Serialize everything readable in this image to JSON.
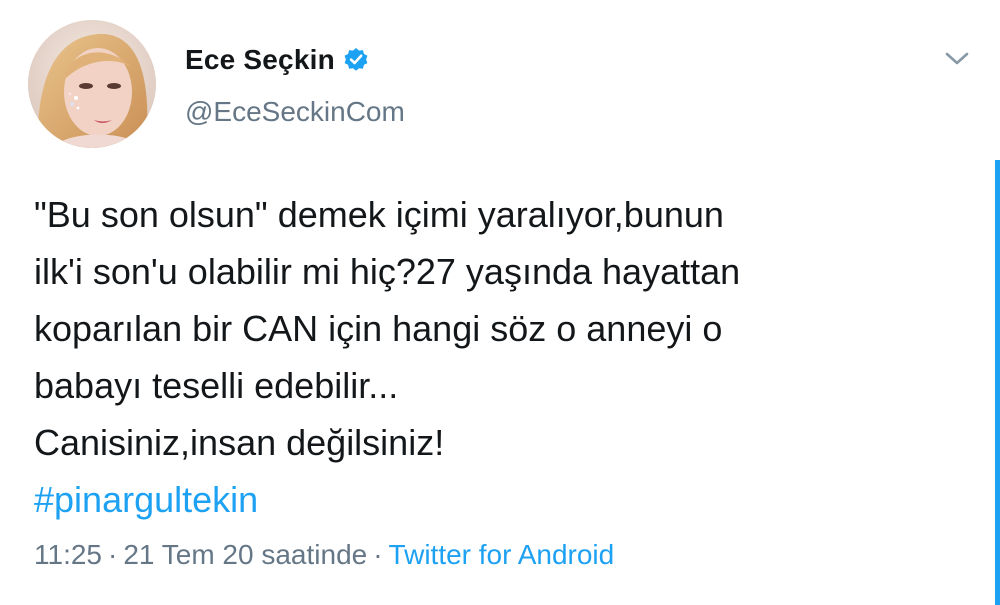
{
  "user": {
    "display_name": "Ece Seçkin",
    "handle": "@EceSeckinCom",
    "verified": true
  },
  "tweet": {
    "lines": [
      "\"Bu son olsun\" demek içimi yaralıyor,bunun",
      "ilk'i son'u olabilir mi hiç?27 yaşında hayattan",
      "koparılan bir CAN için hangi söz o anneyi o",
      "babayı teselli edebilir...",
      "Canisiniz,insan değilsiniz!"
    ],
    "hashtag": "#pinargultekin"
  },
  "meta": {
    "time": "11:25",
    "date": "21 Tem 20 saatinde",
    "separator": "·",
    "source": "Twitter for Android"
  },
  "icons": {
    "verified": "verified-badge-icon",
    "menu": "chevron-down-icon"
  },
  "colors": {
    "link": "#1da1f2",
    "secondary_text": "#657786",
    "primary_text": "#14171a"
  }
}
